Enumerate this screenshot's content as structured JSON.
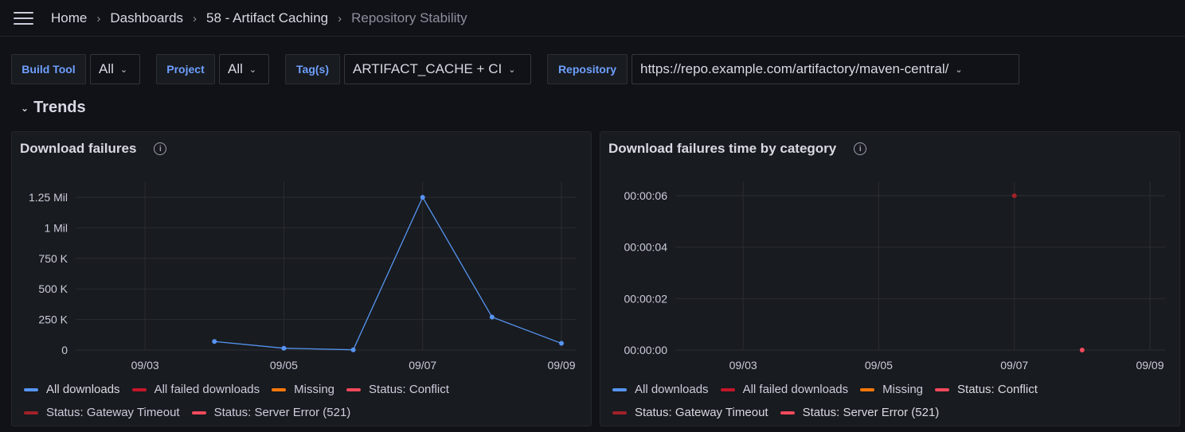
{
  "breadcrumb": {
    "home": "Home",
    "dashboards": "Dashboards",
    "folder": "58 - Artifact Caching",
    "current": "Repository Stability"
  },
  "variables": {
    "build_tool": {
      "label": "Build Tool",
      "value": "All"
    },
    "project": {
      "label": "Project",
      "value": "All"
    },
    "tags": {
      "label": "Tag(s)",
      "value": "ARTIFACT_CACHE + CI"
    },
    "repository": {
      "label": "Repository",
      "value": "https://repo.example.com/artifactory/maven-central/"
    }
  },
  "row": {
    "title": "Trends"
  },
  "icons": {
    "menu": "hamburger-icon",
    "info": "info-icon",
    "caret": "chevron-down-icon"
  },
  "legend": [
    {
      "name": "All downloads",
      "color": "#5794f2"
    },
    {
      "name": "All failed downloads",
      "color": "#c4162a"
    },
    {
      "name": "Missing",
      "color": "#ff780a"
    },
    {
      "name": "Status: Conflict",
      "color": "#f2495c"
    },
    {
      "name": "Status: Gateway Timeout",
      "color": "#a1212a"
    },
    {
      "name": "Status: Server Error (521)",
      "color": "#f2495c"
    }
  ],
  "chart_data": [
    {
      "type": "line",
      "title": "Download failures",
      "x_ticks": [
        "09/03",
        "09/05",
        "09/07",
        "09/09"
      ],
      "y_ticks": [
        "0",
        "250 K",
        "500 K",
        "750 K",
        "1 Mil",
        "1.25 Mil"
      ],
      "ylim": [
        0,
        1250000
      ],
      "xlim": [
        "09/02",
        "09/09"
      ],
      "grid": true,
      "legend_position": "bottom",
      "series": [
        {
          "name": "All downloads",
          "color": "#5794f2",
          "points": [
            {
              "x": "09/04",
              "y": 70000
            },
            {
              "x": "09/05",
              "y": 15000
            },
            {
              "x": "09/06",
              "y": 2000
            },
            {
              "x": "09/07",
              "y": 1250000
            },
            {
              "x": "09/08",
              "y": 270000
            },
            {
              "x": "09/09",
              "y": 55000
            }
          ]
        }
      ]
    },
    {
      "type": "scatter",
      "title": "Download failures time by category",
      "x_ticks": [
        "09/03",
        "09/05",
        "09/07",
        "09/09"
      ],
      "y_ticks": [
        "00:00:00",
        "00:00:02",
        "00:00:04",
        "00:00:06"
      ],
      "ylim": [
        0,
        6
      ],
      "xlim": [
        "09/02",
        "09/09"
      ],
      "grid": true,
      "legend_position": "bottom",
      "series": [
        {
          "name": "Status: Gateway Timeout",
          "color": "#a1212a",
          "points": [
            {
              "x": "09/07",
              "y": 6
            }
          ]
        },
        {
          "name": "Status: Server Error (521)",
          "color": "#f2495c",
          "points": [
            {
              "x": "09/08",
              "y": 0
            }
          ]
        }
      ]
    }
  ]
}
